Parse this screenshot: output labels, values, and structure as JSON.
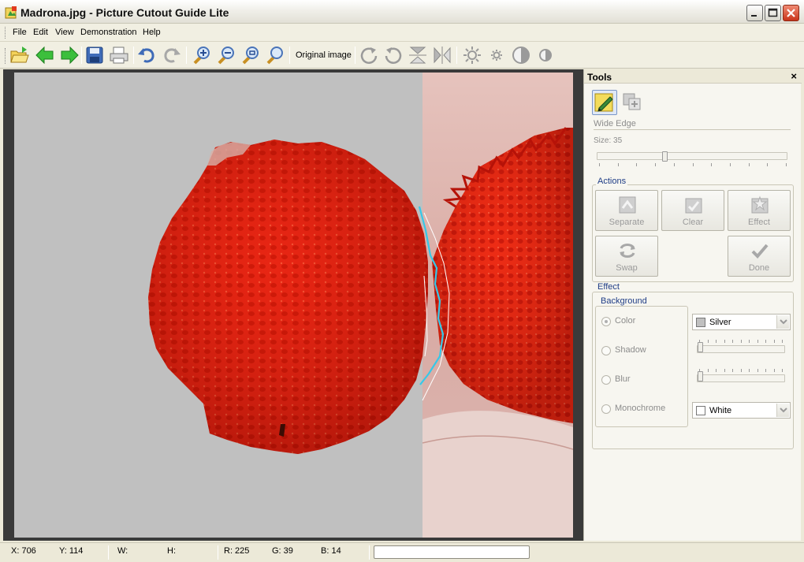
{
  "window": {
    "title": "Madrona.jpg - Picture Cutout Guide Lite",
    "controls": [
      "minimize",
      "maximize",
      "close"
    ]
  },
  "menu": [
    "File",
    "Edit",
    "View",
    "Demonstration",
    "Help"
  ],
  "toolbar": {
    "original_image_label": "Original image",
    "icons": [
      "open-folder-icon",
      "back-arrow-icon",
      "forward-arrow-icon",
      "save-icon",
      "print-icon",
      "undo-icon",
      "redo-icon",
      "zoom-in-icon",
      "zoom-out-icon",
      "zoom-fit-icon",
      "zoom-actual-icon",
      "rotate-cw-icon",
      "rotate-ccw-icon",
      "flip-vertical-icon",
      "flip-horizontal-icon",
      "brightness-up-icon",
      "brightness-down-icon",
      "contrast-up-icon",
      "contrast-down-icon"
    ]
  },
  "tools": {
    "title": "Tools",
    "close_label": "×",
    "mode": "Wide Edge",
    "size_label": "Size: 35",
    "size": 35,
    "size_max": 100,
    "actions": {
      "title": "Actions",
      "buttons": [
        "Separate",
        "Clear",
        "Effect",
        "Swap",
        "Done"
      ]
    },
    "effect": {
      "title": "Effect",
      "background": {
        "title": "Background",
        "options": [
          "Color",
          "Shadow",
          "Blur",
          "Monochrome"
        ],
        "selected": "Color"
      },
      "color_value": "Silver",
      "color_swatch": "#c0c0c0",
      "monochrome_value": "White",
      "monochrome_swatch": "#ffffff",
      "shadow_level": 0,
      "blur_level": 0
    }
  },
  "status": {
    "x": "X: 706",
    "y": "Y: 114",
    "w": "W:",
    "h": "H:",
    "r": "R: 225",
    "g": "G: 39",
    "b": "B: 14"
  },
  "colors": {
    "accent_blue": "#1f3d86",
    "selection_line": "#36c8e8",
    "berry_red": "#e02010",
    "background_silver": "#c0c0c0"
  }
}
